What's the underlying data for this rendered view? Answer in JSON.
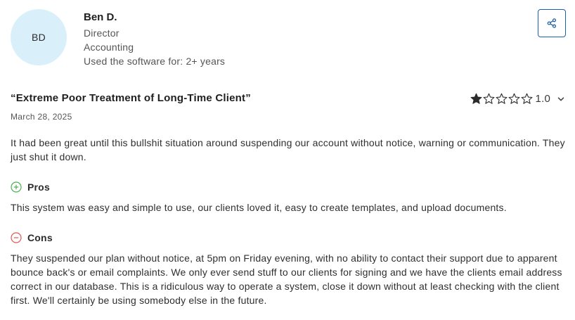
{
  "reviewer": {
    "initials": "BD",
    "name": "Ben D.",
    "role": "Director",
    "department": "Accounting",
    "usage": "Used the software for: 2+ years"
  },
  "review": {
    "title": "“Extreme Poor Treatment of Long-Time Client”",
    "date": "March 28, 2025",
    "rating": "1.0",
    "rating_filled_stars": 1,
    "rating_total_stars": 5,
    "summary": "It had been great until this bullshit situation around suspending our account without notice, warning or communication. They just shut it down.",
    "pros_label": "Pros",
    "pros": "This system was easy and simple to use, our clients loved it, easy to create templates, and upload documents.",
    "cons_label": "Cons",
    "cons": "They suspended our plan without notice, at 5pm on Friday evening, with no ability to contact their support due to apparent bounce back's or email complaints. We only ever send stuff to our clients for signing and we have the clients email address correct in our database. This is a ridiculous way to operate a system, close it down without at least checking with the client first. We'll certainly be using somebody else in the future."
  },
  "icons": {
    "share": "share-icon",
    "pros": "plus-circle-icon",
    "cons": "minus-circle-icon",
    "expand": "chevron-down-icon"
  },
  "colors": {
    "avatar_bg": "#d9f0fb",
    "share_border": "#1f5fa8",
    "pros_icon": "#4caf50",
    "cons_icon": "#e05a4f",
    "star": "#2b2b2b"
  }
}
